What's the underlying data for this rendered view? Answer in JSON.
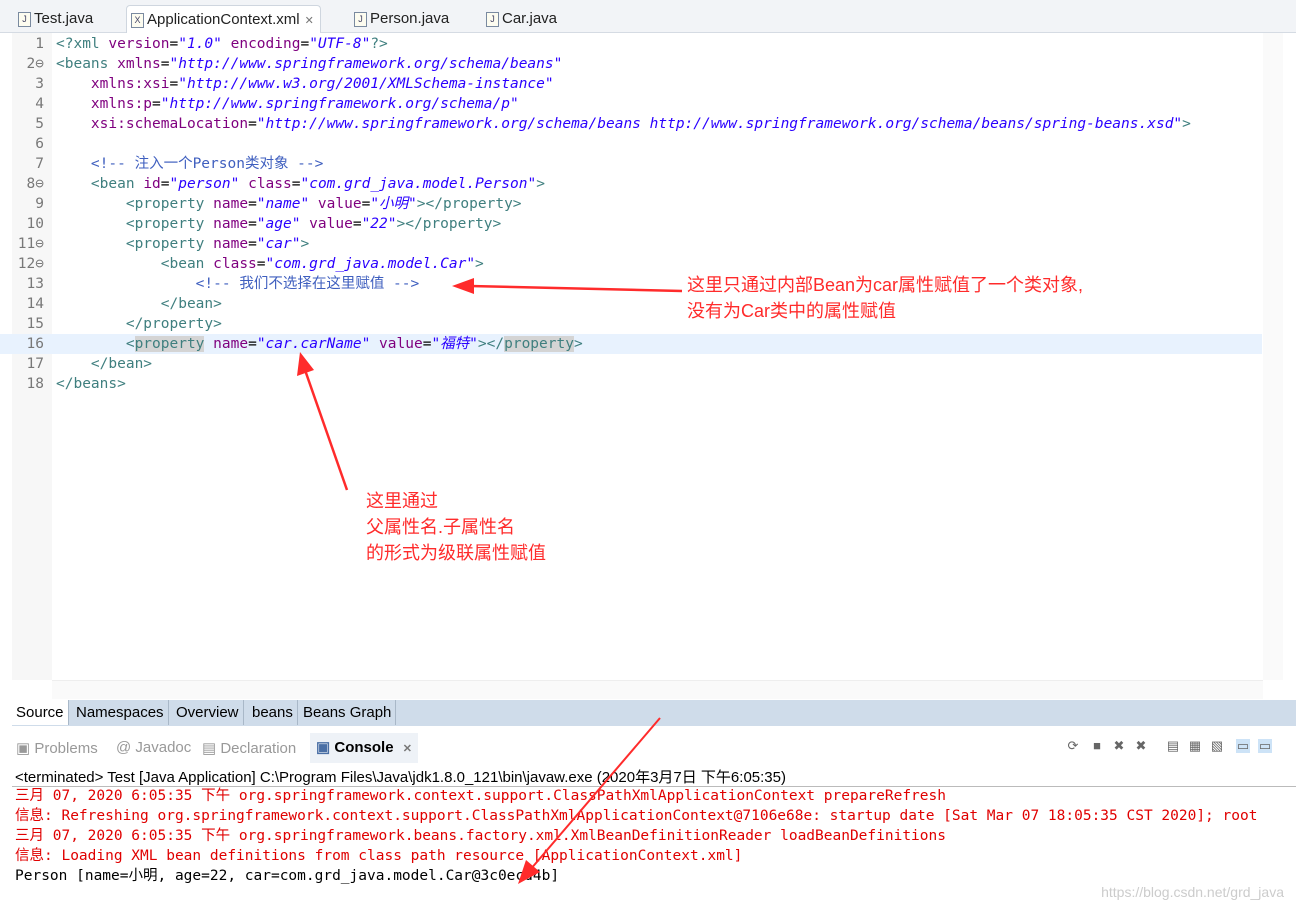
{
  "tabs": [
    {
      "label": "Test.java",
      "icon": "java-file-icon"
    },
    {
      "label": "ApplicationContext.xml",
      "icon": "xml-file-icon",
      "active": true
    },
    {
      "label": "Person.java",
      "icon": "java-file-icon"
    },
    {
      "label": "Car.java",
      "icon": "java-file-icon"
    }
  ],
  "code": [
    [
      [
        "t",
        "<?xml "
      ],
      [
        "a",
        "version"
      ],
      [
        "p",
        "="
      ],
      [
        "v",
        "\"1.0\""
      ],
      [
        "a",
        " encoding"
      ],
      [
        "p",
        "="
      ],
      [
        "v",
        "\"UTF-8\""
      ],
      [
        "t",
        "?>"
      ]
    ],
    [
      [
        "t",
        "<beans "
      ],
      [
        "a",
        "xmlns"
      ],
      [
        "p",
        "="
      ],
      [
        "v",
        "\"http://www.springframework.org/schema/beans\""
      ]
    ],
    [
      [
        "a",
        "    xmlns:xsi"
      ],
      [
        "p",
        "="
      ],
      [
        "v",
        "\"http://www.w3.org/2001/XMLSchema-instance\""
      ]
    ],
    [
      [
        "a",
        "    xmlns:p"
      ],
      [
        "p",
        "="
      ],
      [
        "v",
        "\"http://www.springframework.org/schema/p\""
      ]
    ],
    [
      [
        "a",
        "    xsi:schemaLocation"
      ],
      [
        "p",
        "="
      ],
      [
        "v",
        "\"http://www.springframework.org/schema/beans http://www.springframework.org/schema/beans/spring-beans.xsd\""
      ],
      [
        "t",
        ">"
      ]
    ],
    [],
    [
      [
        "c",
        "    <!-- 注入一个Person类对象 -->"
      ]
    ],
    [
      [
        "t",
        "    <bean "
      ],
      [
        "a",
        "id"
      ],
      [
        "p",
        "="
      ],
      [
        "v",
        "\"person\""
      ],
      [
        "a",
        " class"
      ],
      [
        "p",
        "="
      ],
      [
        "v",
        "\"com.grd_java.model.Person\""
      ],
      [
        "t",
        ">"
      ]
    ],
    [
      [
        "t",
        "        <property "
      ],
      [
        "a",
        "name"
      ],
      [
        "p",
        "="
      ],
      [
        "v",
        "\"name\""
      ],
      [
        "a",
        " value"
      ],
      [
        "p",
        "="
      ],
      [
        "v",
        "\"小明\""
      ],
      [
        "t",
        "></property>"
      ]
    ],
    [
      [
        "t",
        "        <property "
      ],
      [
        "a",
        "name"
      ],
      [
        "p",
        "="
      ],
      [
        "v",
        "\"age\""
      ],
      [
        "a",
        " value"
      ],
      [
        "p",
        "="
      ],
      [
        "v",
        "\"22\""
      ],
      [
        "t",
        "></property>"
      ]
    ],
    [
      [
        "t",
        "        <property "
      ],
      [
        "a",
        "name"
      ],
      [
        "p",
        "="
      ],
      [
        "v",
        "\"car\""
      ],
      [
        "t",
        ">"
      ]
    ],
    [
      [
        "t",
        "            <bean "
      ],
      [
        "a",
        "class"
      ],
      [
        "p",
        "="
      ],
      [
        "v",
        "\"com.grd_java.model.Car\""
      ],
      [
        "t",
        ">"
      ]
    ],
    [
      [
        "c",
        "                <!-- 我们不选择在这里赋值 -->"
      ]
    ],
    [
      [
        "t",
        "            </bean>"
      ]
    ],
    [
      [
        "t",
        "        </property>"
      ]
    ],
    [
      [
        "t",
        "        <"
      ],
      [
        "th",
        "property"
      ],
      [
        "a",
        " name"
      ],
      [
        "p",
        "="
      ],
      [
        "v",
        "\"car.carName\""
      ],
      [
        "a",
        " value"
      ],
      [
        "p",
        "="
      ],
      [
        "v",
        "\"福特\""
      ],
      [
        "t",
        "></"
      ],
      [
        "th",
        "property"
      ],
      [
        "t",
        ">"
      ]
    ],
    [
      [
        "t",
        "    </bean>"
      ]
    ],
    [
      [
        "t",
        "</beans>"
      ]
    ]
  ],
  "fold_lines": [
    2,
    8,
    11,
    12
  ],
  "current_line": 16,
  "bottom_tabs": [
    "Source",
    "Namespaces",
    "Overview",
    "beans",
    "Beans Graph"
  ],
  "console_tabs": [
    "Problems",
    "Javadoc",
    "Declaration",
    "Console"
  ],
  "terminated": "<terminated> Test [Java Application] C:\\Program Files\\Java\\jdk1.8.0_121\\bin\\javaw.exe (2020年3月7日 下午6:05:35)",
  "console": [
    {
      "text": "三月 07, 2020 6:05:35 下午 org.springframework.context.support.ClassPathXmlApplicationContext prepareRefresh",
      "color": "red"
    },
    {
      "text": "信息: Refreshing org.springframework.context.support.ClassPathXmlApplicationContext@7106e68e: startup date [Sat Mar 07 18:05:35 CST 2020]; root",
      "color": "red"
    },
    {
      "text": "三月 07, 2020 6:05:35 下午 org.springframework.beans.factory.xml.XmlBeanDefinitionReader loadBeanDefinitions",
      "color": "red"
    },
    {
      "text": "信息: Loading XML bean definitions from class path resource [ApplicationContext.xml]",
      "color": "red"
    },
    {
      "text": "Person [name=小明, age=22, car=com.grd_java.model.Car@3c0ecd4b]",
      "color": "black"
    }
  ],
  "annotations": {
    "inner_bean": "这里只通过内部Bean为car属性赋值了一个类对象,\n没有为Car类中的属性赋值",
    "cascade": "这里通过\n父属性名.子属性名\n的形式为级联属性赋值"
  },
  "watermark": "https://blog.csdn.net/grd_java",
  "colors": {
    "annotation": "#ff2b2b",
    "tag": "#3f7f7f",
    "attr": "#7f007f",
    "value": "#2a00ff",
    "comment": "#3f5fbf"
  }
}
